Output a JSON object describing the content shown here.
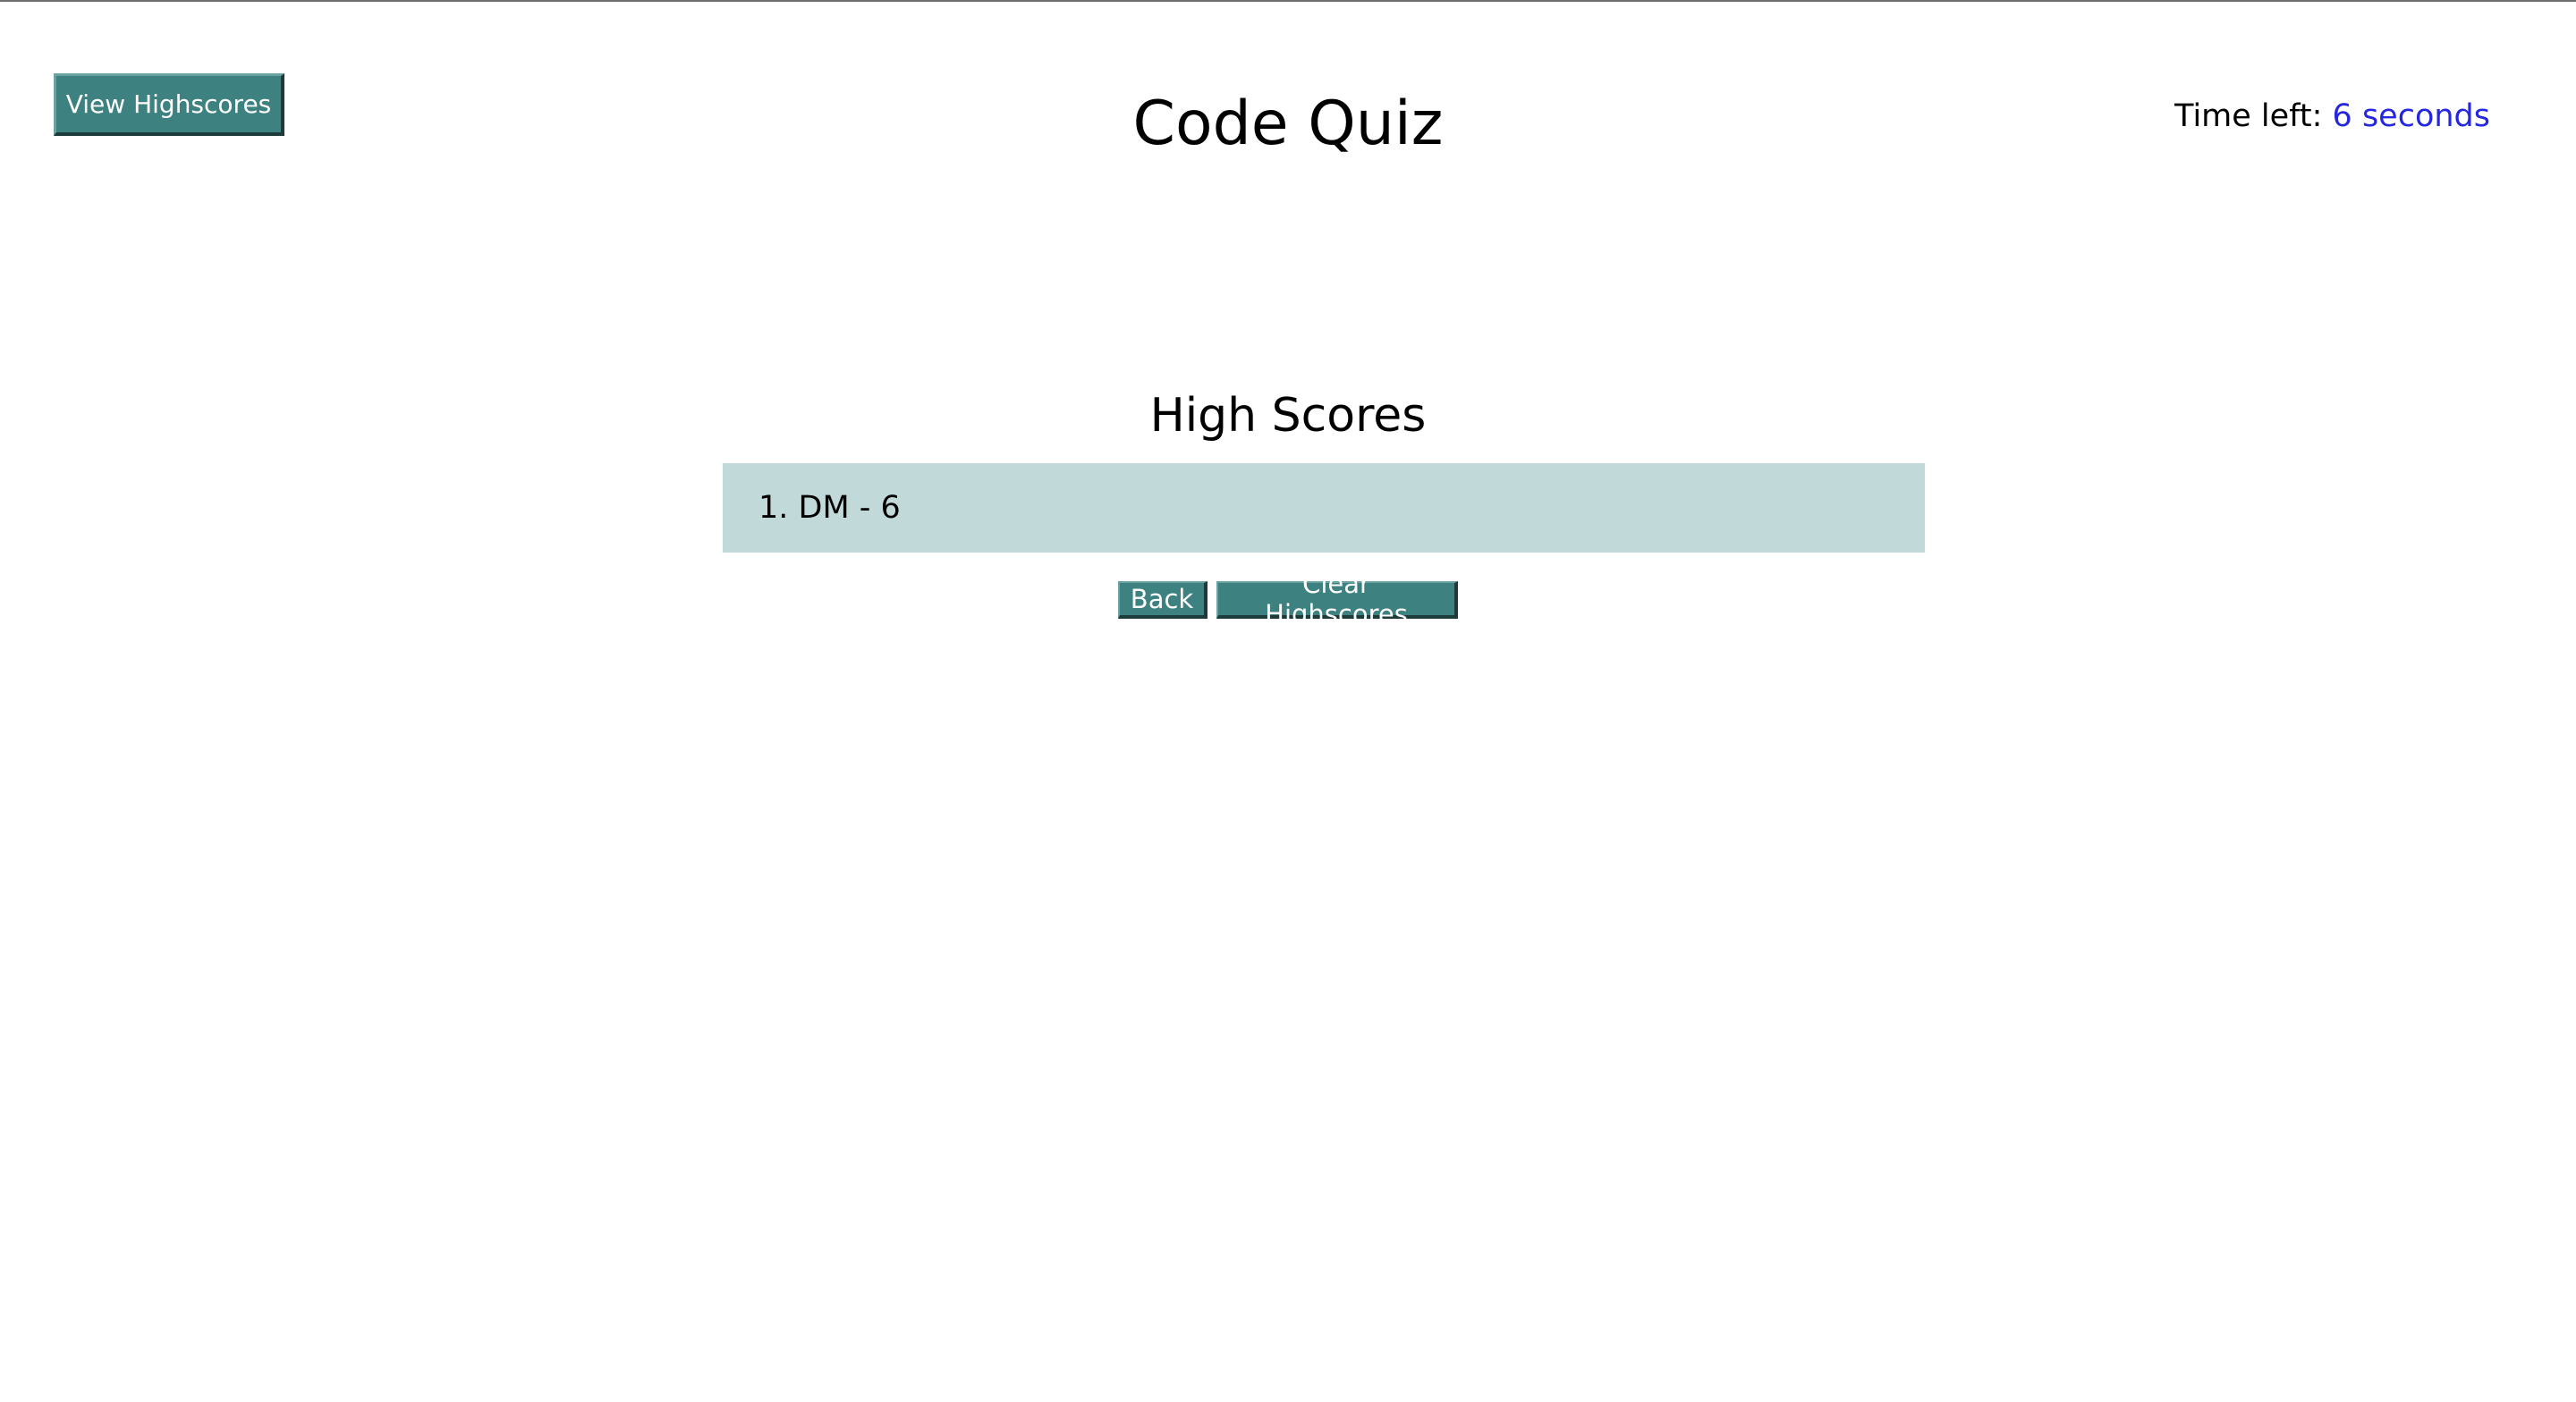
{
  "header": {
    "view_highscores_label": "View Highscores",
    "title": "Code Quiz",
    "timer_label": "Time left: ",
    "timer_value": "6 seconds"
  },
  "highscores": {
    "heading": "High Scores",
    "entries": [
      {
        "text": "1. DM - 6"
      }
    ],
    "back_label": "Back",
    "clear_label": "Clear Highscores"
  },
  "colors": {
    "button_bg": "#3d8180",
    "list_bg": "#c2d9da",
    "timer_value": "#2526e0"
  }
}
